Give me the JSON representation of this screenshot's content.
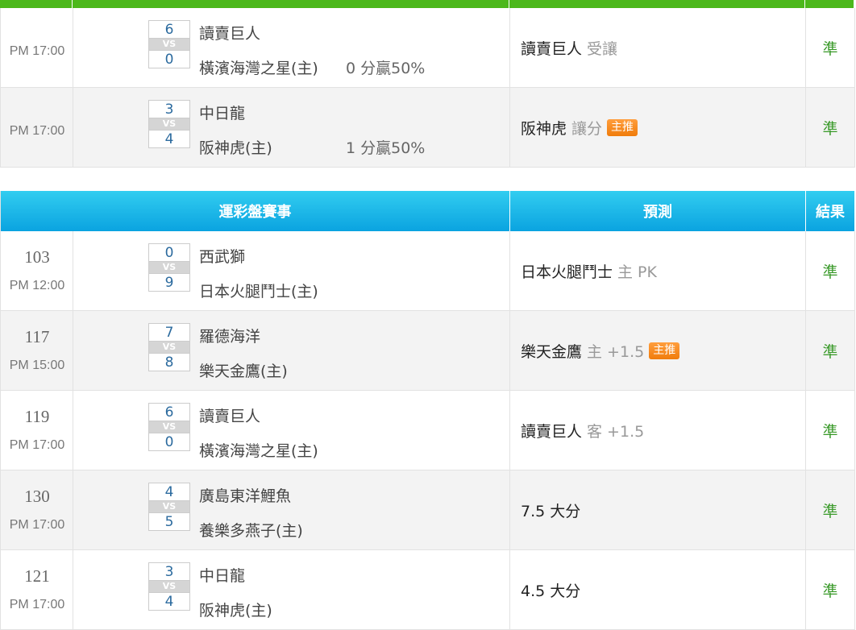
{
  "colors": {
    "accent_green": "#4cb81b",
    "header_blue": "#0aa3e0",
    "result_green": "#3a9a2a",
    "badge_orange": "#f07c0b",
    "score_blue": "#2b6a9e"
  },
  "top_table": {
    "rows": [
      {
        "time": "PM 17:00",
        "away_score": "6",
        "vs": "VS",
        "home_score": "0",
        "away_team": "讀賣巨人",
        "home_team": "橫濱海灣之星(主)",
        "handicap": "0 分贏50%",
        "pick": "讀賣巨人",
        "pick_note": "受讓",
        "badge": "",
        "result": "準"
      },
      {
        "time": "PM 17:00",
        "away_score": "3",
        "vs": "VS",
        "home_score": "4",
        "away_team": "中日龍",
        "home_team": "阪神虎(主)",
        "handicap": "1 分贏50%",
        "pick": "阪神虎",
        "pick_note": "讓分",
        "badge": "主推",
        "result": "準"
      }
    ]
  },
  "main_table": {
    "header": {
      "matches": "運彩盤賽事",
      "prediction": "預測",
      "result": "結果"
    },
    "rows": [
      {
        "id": "103",
        "time": "PM 12:00",
        "away_score": "0",
        "vs": "VS",
        "home_score": "9",
        "away_team": "西武獅",
        "home_team": "日本火腿鬥士(主)",
        "pick": "日本火腿鬥士",
        "pick_note": "主 PK",
        "badge": "",
        "result": "準"
      },
      {
        "id": "117",
        "time": "PM 15:00",
        "away_score": "7",
        "vs": "VS",
        "home_score": "8",
        "away_team": "羅德海洋",
        "home_team": "樂天金鷹(主)",
        "pick": "樂天金鷹",
        "pick_note": "主 +1.5",
        "badge": "主推",
        "result": "準"
      },
      {
        "id": "119",
        "time": "PM 17:00",
        "away_score": "6",
        "vs": "VS",
        "home_score": "0",
        "away_team": "讀賣巨人",
        "home_team": "橫濱海灣之星(主)",
        "pick": "讀賣巨人",
        "pick_note": "客 +1.5",
        "badge": "",
        "result": "準"
      },
      {
        "id": "130",
        "time": "PM 17:00",
        "away_score": "4",
        "vs": "VS",
        "home_score": "5",
        "away_team": "廣島東洋鯉魚",
        "home_team": "養樂多燕子(主)",
        "pick": "7.5 大分",
        "pick_note": "",
        "badge": "",
        "result": "準"
      },
      {
        "id": "121",
        "time": "PM 17:00",
        "away_score": "3",
        "vs": "VS",
        "home_score": "4",
        "away_team": "中日龍",
        "home_team": "阪神虎(主)",
        "pick": "4.5 大分",
        "pick_note": "",
        "badge": "",
        "result": "準"
      }
    ]
  }
}
